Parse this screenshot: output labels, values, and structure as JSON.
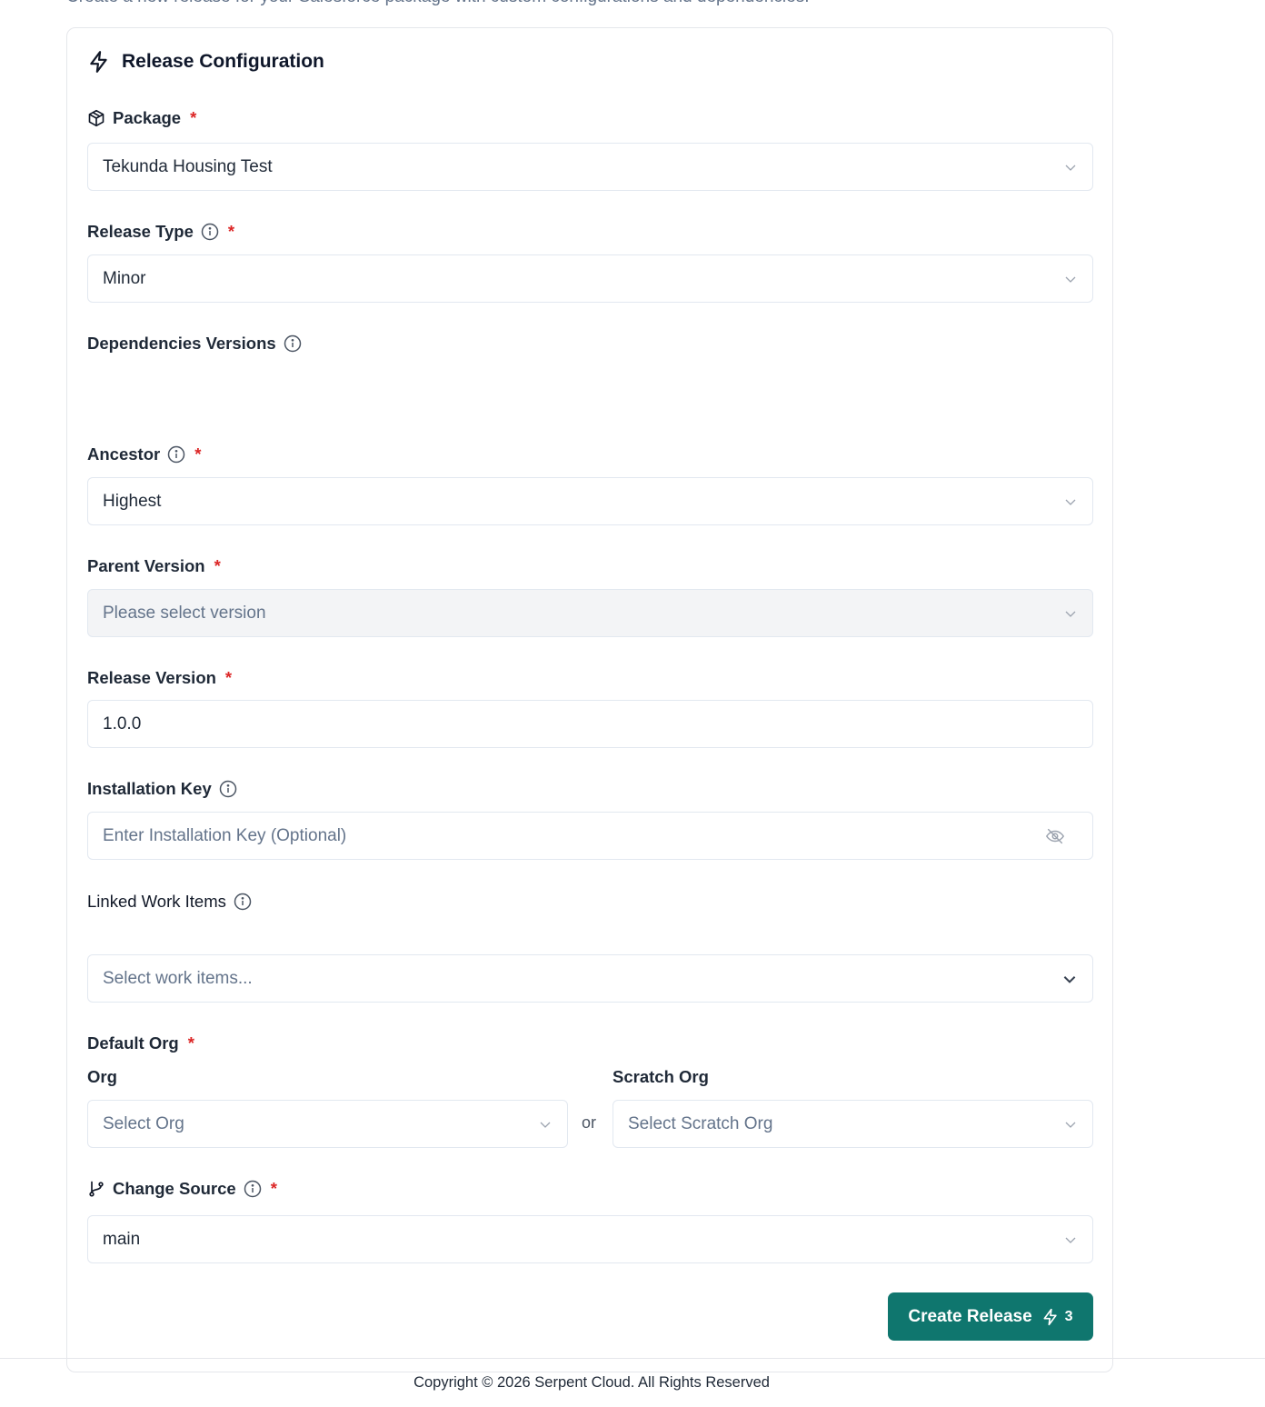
{
  "page": {
    "subtitle": "Create a new release for your Salesforce package with custom configurations and dependencies."
  },
  "card": {
    "title": "Release Configuration",
    "title_icon": "lightning-icon"
  },
  "fields": {
    "package": {
      "label": "Package",
      "value": "Tekunda Housing Test",
      "icon": "package-icon",
      "required": "*"
    },
    "release_type": {
      "label": "Release Type",
      "value": "Minor",
      "required": "*"
    },
    "dependencies_versions": {
      "label": "Dependencies Versions"
    },
    "ancestor": {
      "label": "Ancestor",
      "value": "Highest",
      "required": "*"
    },
    "parent_version": {
      "label": "Parent Version",
      "placeholder": "Please select version",
      "required": "*"
    },
    "release_version": {
      "label": "Release Version",
      "value": "1.0.0",
      "required": "*"
    },
    "installation_key": {
      "label": "Installation Key",
      "placeholder": "Enter Installation Key (Optional)"
    },
    "linked_work_items": {
      "label": "Linked Work Items",
      "placeholder": "Select work items..."
    },
    "default_org": {
      "label": "Default Org",
      "required": "*",
      "org_label": "Org",
      "org_placeholder": "Select Org",
      "or_text": "or",
      "scratch_label": "Scratch Org",
      "scratch_placeholder": "Select Scratch Org"
    },
    "change_source": {
      "label": "Change Source",
      "value": "main",
      "icon": "git-branch-icon",
      "required": "*"
    }
  },
  "actions": {
    "create_release_label": "Create Release",
    "create_release_count": "3"
  },
  "footer": {
    "copyright": "Copyright © 2026 Serpent Cloud. All Rights Reserved"
  },
  "colors": {
    "primary": "#0f766e",
    "required": "#dc2626",
    "border": "#e2e8f0"
  }
}
